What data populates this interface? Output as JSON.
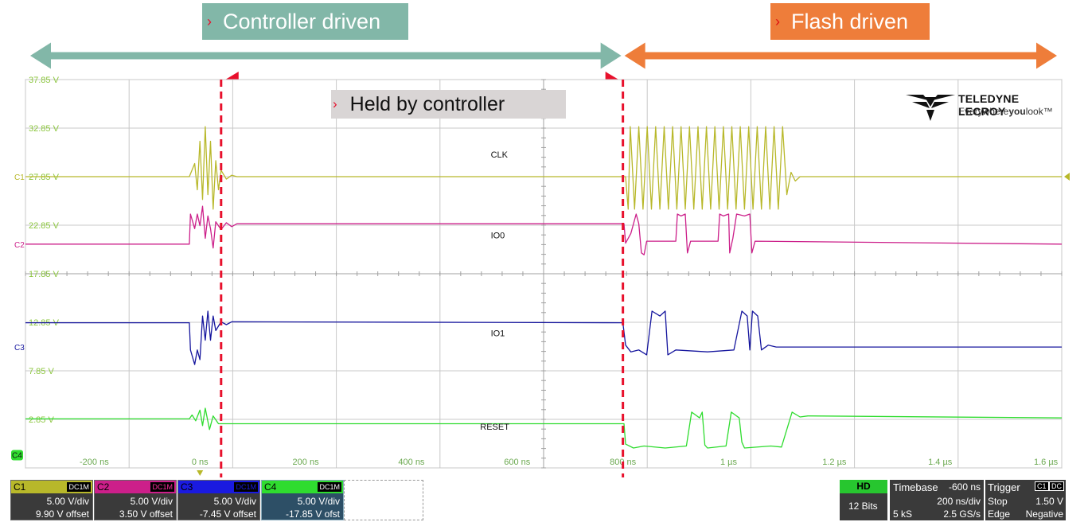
{
  "annotations": {
    "controller_driven": "Controller driven",
    "flash_driven": "Flash driven",
    "held_by_controller": "Held by controller",
    "chevron": "›"
  },
  "colors": {
    "controller_teal": "#82b7a8",
    "flash_orange": "#ee7d3a",
    "held_red": "#e8102c",
    "grid": "#c8c8c8",
    "c1": "#b8b82a",
    "c2": "#cc1f8a",
    "c3": "#16169e",
    "c4": "#2fdc2f",
    "y_label": "#8cc63f"
  },
  "logo": {
    "brand": "TELEDYNE LECROY",
    "tagline_a": "Everywhere",
    "tagline_b": "you",
    "tagline_c": "look",
    "tagline_d": "™"
  },
  "chart_data": {
    "type": "line",
    "title": "",
    "xlabel": "",
    "ylabel": "",
    "x_unit": "ns",
    "xlim": [
      -330,
      1630
    ],
    "ylim": [
      -2.15,
      37.85
    ],
    "x_ticks": [
      -200,
      0,
      200,
      400,
      600,
      800,
      1000,
      1200,
      1400,
      1600
    ],
    "x_tick_labels": [
      "-200 ns",
      "0 ns",
      "200 ns",
      "400 ns",
      "600 ns",
      "800 ns",
      "1 µs",
      "1.2 µs",
      "1.4 µs",
      "1.6 µs"
    ],
    "y_tick_labels": [
      {
        "v": 37.85,
        "label": "37.85 V"
      },
      {
        "v": 32.85,
        "label": "32.85 V"
      },
      {
        "v": 27.85,
        "label": "27.85 V"
      },
      {
        "v": 22.85,
        "label": "22.85 V"
      },
      {
        "v": 17.85,
        "label": "17.85 V"
      },
      {
        "v": 12.85,
        "label": "12.85 V"
      },
      {
        "v": 7.85,
        "label": "7.85 V"
      },
      {
        "v": 2.85,
        "label": "2.85 V"
      }
    ],
    "grid": true,
    "markers": {
      "held_start_ns": 40,
      "held_end_ns": 800
    },
    "series": [
      {
        "name": "CLK",
        "channel": "C1",
        "color": "#b8b82a",
        "label_x": 550,
        "label_y": 29.8,
        "points": [
          [
            -330,
            27.85
          ],
          [
            -20,
            27.85
          ],
          [
            -10,
            29.2
          ],
          [
            -5,
            26.5
          ],
          [
            0,
            31.5
          ],
          [
            5,
            25.5
          ],
          [
            10,
            33
          ],
          [
            15,
            26
          ],
          [
            20,
            31.5
          ],
          [
            25,
            24.5
          ],
          [
            30,
            29.5
          ],
          [
            35,
            26.5
          ],
          [
            40,
            28.5
          ],
          [
            50,
            27.6
          ],
          [
            60,
            28
          ],
          [
            70,
            27.85
          ],
          [
            800,
            27.85
          ],
          [
            805,
            27.85
          ],
          [
            810,
            24.5
          ],
          [
            814,
            33
          ],
          [
            822,
            24.5
          ],
          [
            830,
            33
          ],
          [
            838,
            24.5
          ],
          [
            846,
            33
          ],
          [
            854,
            24.5
          ],
          [
            862,
            33
          ],
          [
            870,
            24.5
          ],
          [
            878,
            33
          ],
          [
            886,
            24.5
          ],
          [
            894,
            33
          ],
          [
            902,
            24.5
          ],
          [
            910,
            33
          ],
          [
            918,
            24.5
          ],
          [
            926,
            33
          ],
          [
            934,
            24.5
          ],
          [
            942,
            33
          ],
          [
            950,
            24.5
          ],
          [
            958,
            33
          ],
          [
            966,
            24.5
          ],
          [
            974,
            33
          ],
          [
            982,
            24.5
          ],
          [
            990,
            33
          ],
          [
            998,
            24.5
          ],
          [
            1006,
            33
          ],
          [
            1014,
            24.5
          ],
          [
            1022,
            33
          ],
          [
            1030,
            24.5
          ],
          [
            1038,
            33
          ],
          [
            1046,
            24.5
          ],
          [
            1054,
            33
          ],
          [
            1062,
            24.5
          ],
          [
            1070,
            33
          ],
          [
            1078,
            24.5
          ],
          [
            1086,
            33
          ],
          [
            1094,
            24.5
          ],
          [
            1102,
            33
          ],
          [
            1110,
            26
          ],
          [
            1118,
            28.3
          ],
          [
            1126,
            27.4
          ],
          [
            1135,
            27.85
          ],
          [
            1630,
            27.85
          ]
        ]
      },
      {
        "name": "IO0",
        "channel": "C2",
        "color": "#cc1f8a",
        "label_x": 550,
        "label_y": 21.5,
        "points": [
          [
            -330,
            20.9
          ],
          [
            -20,
            20.9
          ],
          [
            -18,
            24
          ],
          [
            -10,
            22.5
          ],
          [
            -5,
            24
          ],
          [
            0,
            22.8
          ],
          [
            5,
            24.8
          ],
          [
            10,
            21.5
          ],
          [
            15,
            23.8
          ],
          [
            20,
            22.5
          ],
          [
            25,
            20.5
          ],
          [
            30,
            23.2
          ],
          [
            40,
            22.4
          ],
          [
            50,
            23.1
          ],
          [
            60,
            22.7
          ],
          [
            70,
            23
          ],
          [
            800,
            23
          ],
          [
            802,
            23
          ],
          [
            805,
            21
          ],
          [
            815,
            22
          ],
          [
            825,
            24
          ],
          [
            830,
            23
          ],
          [
            835,
            20
          ],
          [
            840,
            19.8
          ],
          [
            845,
            21.2
          ],
          [
            900,
            21.2
          ],
          [
            903,
            24
          ],
          [
            910,
            23.8
          ],
          [
            918,
            24
          ],
          [
            922,
            20
          ],
          [
            928,
            21.2
          ],
          [
            980,
            21.2
          ],
          [
            983,
            24
          ],
          [
            990,
            23.8
          ],
          [
            1000,
            24
          ],
          [
            1002,
            20
          ],
          [
            1008,
            21.5
          ],
          [
            1015,
            24
          ],
          [
            1030,
            23.8
          ],
          [
            1040,
            24
          ],
          [
            1044,
            20
          ],
          [
            1050,
            21.2
          ],
          [
            1630,
            20.9
          ]
        ]
      },
      {
        "name": "IO1",
        "channel": "C3",
        "color": "#16169e",
        "label_x": 550,
        "label_y": 11.4,
        "points": [
          [
            -330,
            12.8
          ],
          [
            -20,
            12.8
          ],
          [
            -18,
            10
          ],
          [
            -10,
            8.5
          ],
          [
            -5,
            10
          ],
          [
            0,
            9
          ],
          [
            5,
            13.5
          ],
          [
            10,
            11
          ],
          [
            15,
            14
          ],
          [
            20,
            11
          ],
          [
            25,
            13.5
          ],
          [
            30,
            12
          ],
          [
            40,
            12.9
          ],
          [
            50,
            12.6
          ],
          [
            60,
            12.9
          ],
          [
            800,
            12.8
          ],
          [
            805,
            10.5
          ],
          [
            815,
            9.8
          ],
          [
            830,
            10
          ],
          [
            845,
            9.5
          ],
          [
            855,
            14
          ],
          [
            870,
            13.5
          ],
          [
            880,
            14
          ],
          [
            885,
            9.5
          ],
          [
            900,
            10
          ],
          [
            960,
            9.8
          ],
          [
            1010,
            10
          ],
          [
            1025,
            14
          ],
          [
            1035,
            13.5
          ],
          [
            1040,
            10
          ],
          [
            1045,
            14
          ],
          [
            1055,
            13.5
          ],
          [
            1062,
            10
          ],
          [
            1075,
            10.5
          ],
          [
            1090,
            10.3
          ],
          [
            1110,
            10.3
          ],
          [
            1630,
            10.3
          ]
        ]
      },
      {
        "name": "RESET",
        "channel": "C4",
        "color": "#2fdc2f",
        "label_x": 530,
        "label_y": 1.8,
        "points": [
          [
            -330,
            2.9
          ],
          [
            -20,
            2.9
          ],
          [
            -15,
            3.3
          ],
          [
            -8,
            2.7
          ],
          [
            0,
            3.8
          ],
          [
            5,
            2.2
          ],
          [
            10,
            4
          ],
          [
            18,
            1.8
          ],
          [
            25,
            3.2
          ],
          [
            35,
            2.4
          ],
          [
            50,
            2.4
          ],
          [
            800,
            2.4
          ],
          [
            802,
            2.4
          ],
          [
            805,
            0.3
          ],
          [
            820,
            -0.1
          ],
          [
            840,
            0.1
          ],
          [
            880,
            -0.1
          ],
          [
            920,
            0.1
          ],
          [
            930,
            3.6
          ],
          [
            945,
            3
          ],
          [
            950,
            3.6
          ],
          [
            955,
            0.2
          ],
          [
            960,
            -0.1
          ],
          [
            995,
            0.1
          ],
          [
            1005,
            3.6
          ],
          [
            1020,
            3
          ],
          [
            1025,
            0.5
          ],
          [
            1030,
            -0.1
          ],
          [
            1080,
            0.1
          ],
          [
            1100,
            0
          ],
          [
            1120,
            3.6
          ],
          [
            1135,
            3.1
          ],
          [
            1150,
            3.2
          ],
          [
            1630,
            3
          ]
        ]
      }
    ]
  },
  "channels": [
    {
      "name": "C1",
      "coupling": "DC1M",
      "scale": "5.00 V/div",
      "offset": "9.90 V offset",
      "color": "#b8b82a"
    },
    {
      "name": "C2",
      "coupling": "DC1M",
      "scale": "5.00 V/div",
      "offset": "3.50 V offset",
      "color": "#cc1f8a"
    },
    {
      "name": "C3",
      "coupling": "DC1M",
      "scale": "5.00 V/div",
      "offset": "-7.45 V offset",
      "color": "#1a1ae0"
    },
    {
      "name": "C4",
      "coupling": "DC1M",
      "scale": "5.00 V/div",
      "offset": "-17.85 V ofst",
      "color": "#2fdc2f"
    }
  ],
  "channel_markers": [
    "C1",
    "C2",
    "C3",
    "C4"
  ],
  "acquisition": {
    "hd": "HD",
    "bits": "12 Bits",
    "timebase_label": "Timebase",
    "timebase_delay": "-600 ns",
    "timebase_scale": "200 ns/div",
    "samples": "5 kS",
    "sample_rate": "2.5 GS/s",
    "trigger_label": "Trigger",
    "trigger_src": "C1",
    "trigger_coupling": "DC",
    "trigger_mode": "Stop",
    "trigger_level": "1.50 V",
    "trigger_type": "Edge",
    "trigger_slope": "Negative"
  }
}
